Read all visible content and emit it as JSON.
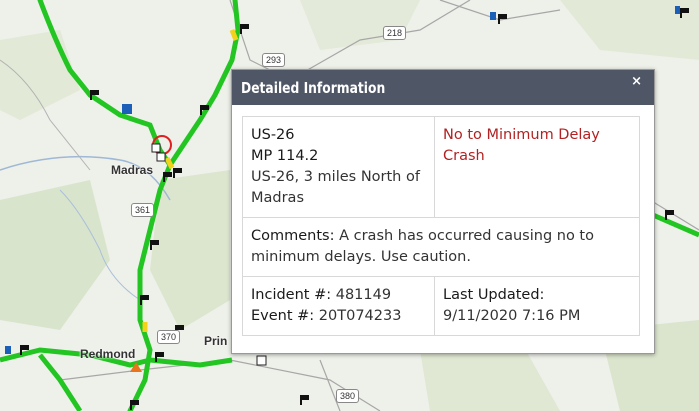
{
  "map": {
    "place_labels": [
      "Madras",
      "Redmond",
      "Prin"
    ],
    "route_shields": [
      "293",
      "218",
      "361",
      "370",
      "380"
    ]
  },
  "popup": {
    "title": "Detailed Information",
    "close_glyph": "×",
    "route": "US-26",
    "milepost": "MP 114.2",
    "location": "US-26, 3 miles North of Madras",
    "incident_type": "No to Minimum Delay Crash",
    "comments_label": "Comments:",
    "comments": "A crash has occurred causing no to minimum delays. Use caution.",
    "incident_label": "Incident #:",
    "incident_number": "481149",
    "event_label": "Event #:",
    "event_number": "20T074233",
    "updated_label": "Last Updated:",
    "updated_value": "9/11/2020 7:16 PM"
  },
  "colors": {
    "road": "#22c522",
    "header": "#4f5666",
    "alert": "#b22222"
  }
}
